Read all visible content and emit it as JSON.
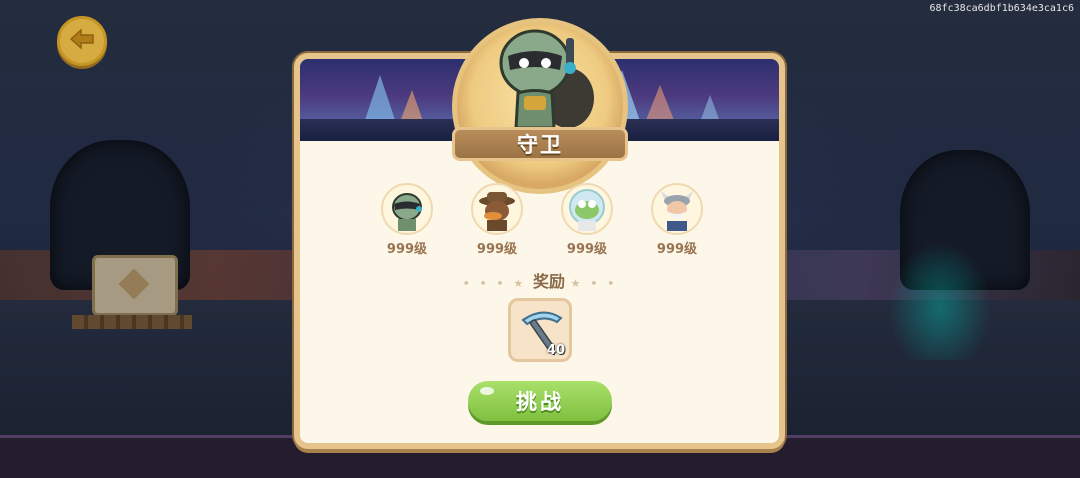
{
  "screen": {
    "code": "68fc38ca6dbf1b634e3ca1c6",
    "accent_gold": "#e7c48c",
    "accent_green": "#8fcc4f"
  },
  "nav": {
    "back_icon": "back-arrow-icon"
  },
  "dialog": {
    "title": "守卫",
    "hero_icon": "turtle-guard-portrait",
    "members": [
      {
        "icon": "turtle-guard-avatar",
        "level": "999级"
      },
      {
        "icon": "platypus-detective-avatar",
        "level": "999级"
      },
      {
        "icon": "frog-astronaut-avatar",
        "level": "999级"
      },
      {
        "icon": "viking-elder-avatar",
        "level": "999级"
      }
    ],
    "reward_label": "奖励",
    "reward": {
      "icon": "pickaxe-icon",
      "count": "40"
    },
    "challenge_label": "挑战"
  }
}
